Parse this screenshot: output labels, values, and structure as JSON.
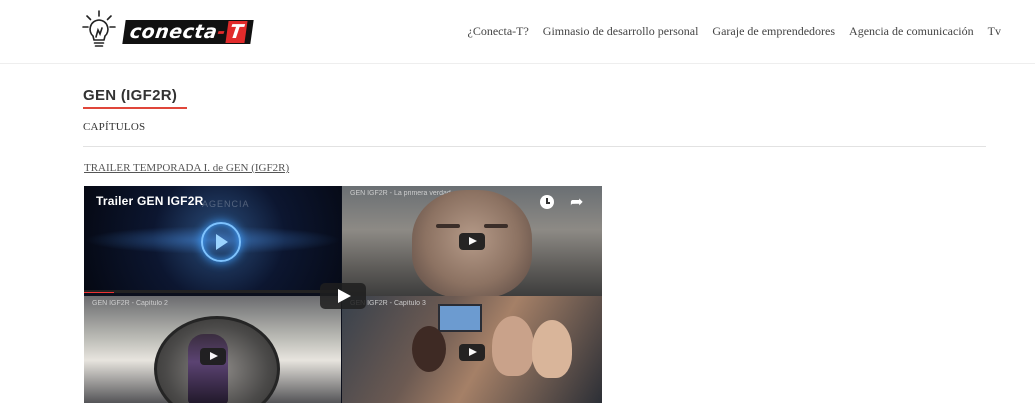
{
  "header": {
    "logo": {
      "text_main": "conecta",
      "text_dash": "-",
      "text_suffix": "T"
    },
    "nav": [
      "¿Conecta-T?",
      "Gimnasio de desarrollo personal",
      "Garaje de emprendedores",
      "Agencia de comunicación",
      "Tv"
    ]
  },
  "main": {
    "title": "GEN (IGF2R)",
    "subheading": "CAPÍTULOS",
    "trailer_link": "TRAILER TEMPORADA I. de GEN (IGF2R)",
    "video": {
      "tile1_title": "Trailer GEN IGF2R",
      "tile1_faint": "AGENCIA",
      "tile2_title": "GEN IGF2R - La primera verdad",
      "tile3_title": "GEN IGF2R - Capítulo 2",
      "tile4_title": "GEN IGF2R - Capítulo 3"
    }
  },
  "colors": {
    "accent": "#e0463a",
    "logo_bg": "#111111",
    "logo_red": "#e12b2b"
  },
  "icons": [
    "bulb-logo-icon",
    "play-icon",
    "clock-icon",
    "share-icon"
  ]
}
